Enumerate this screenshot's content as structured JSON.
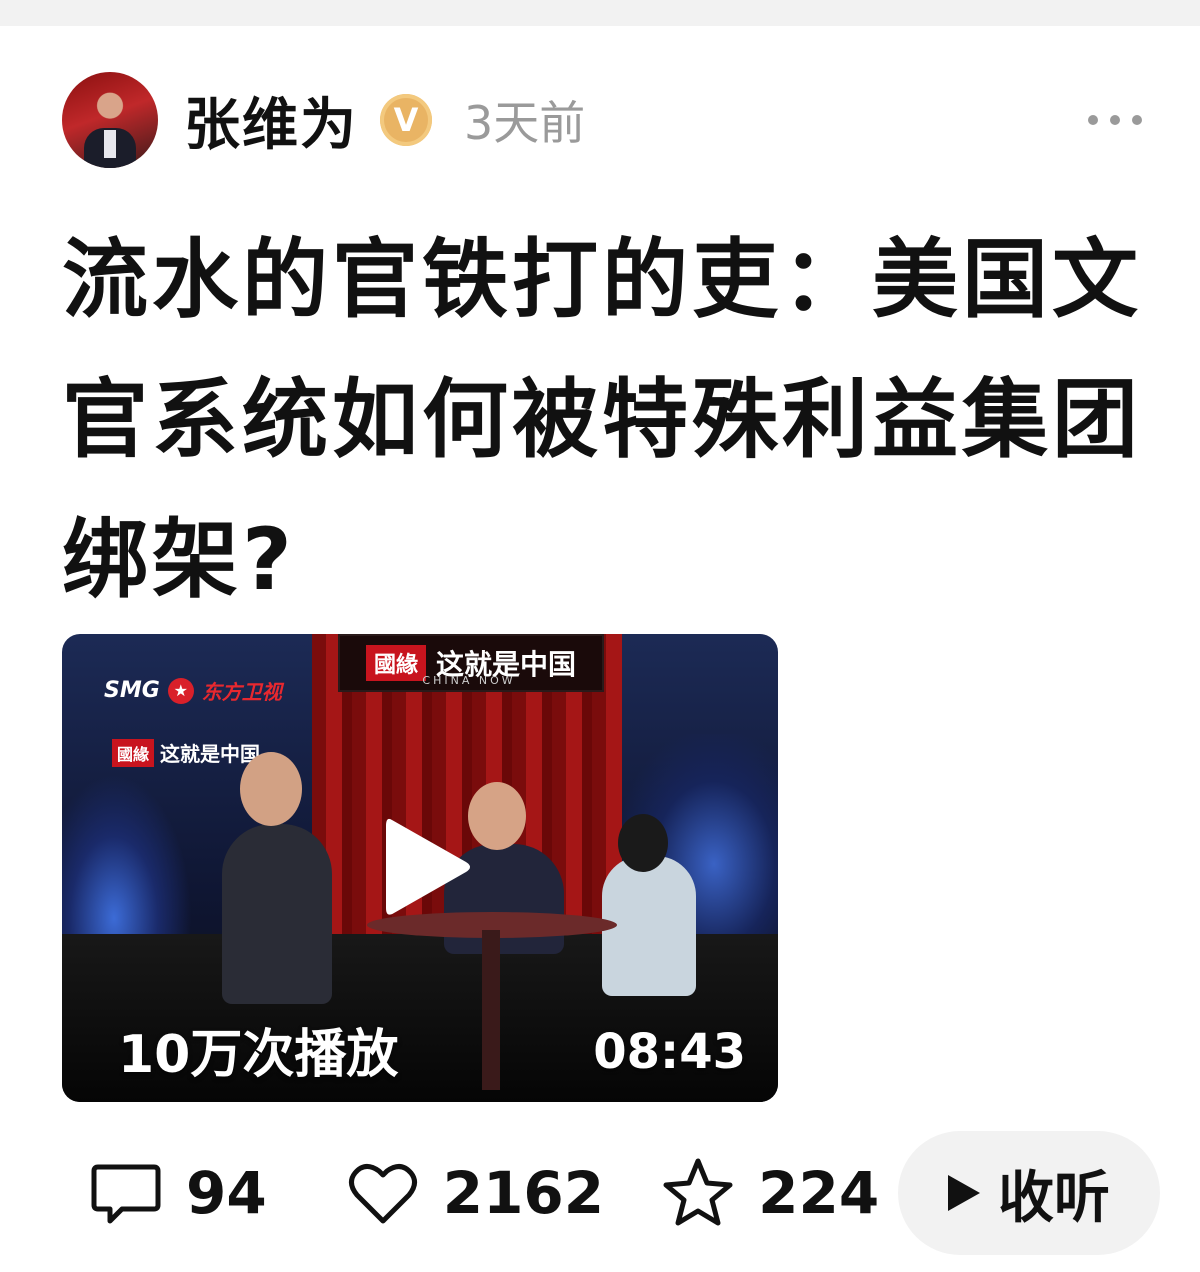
{
  "post": {
    "author": {
      "name": "张维为",
      "verified_badge": "V",
      "time": "3天前"
    },
    "title": "流水的官铁打的吏：美国文官系统如何被特殊利益集团绑架?",
    "video": {
      "view_count": "10万次播放",
      "duration": "08:43",
      "logo_red": "國緣",
      "logo_text": "这就是中国",
      "logo_sub": "CHINA NOW",
      "smg": "SMG",
      "channel": "东方卫视",
      "corner_red": "國緣",
      "corner_text": "这就是中国"
    },
    "actions": {
      "comments": "94",
      "likes": "2162",
      "favorites": "224",
      "listen_label": "收听"
    }
  },
  "icons": [
    "more-icon",
    "comment-icon",
    "like-icon",
    "favorite-icon",
    "play-icon",
    "listen-play-icon"
  ],
  "colors": {
    "badge": "#e9b464",
    "time": "#9a9a9a",
    "listen_bg": "#f2f2f2"
  }
}
